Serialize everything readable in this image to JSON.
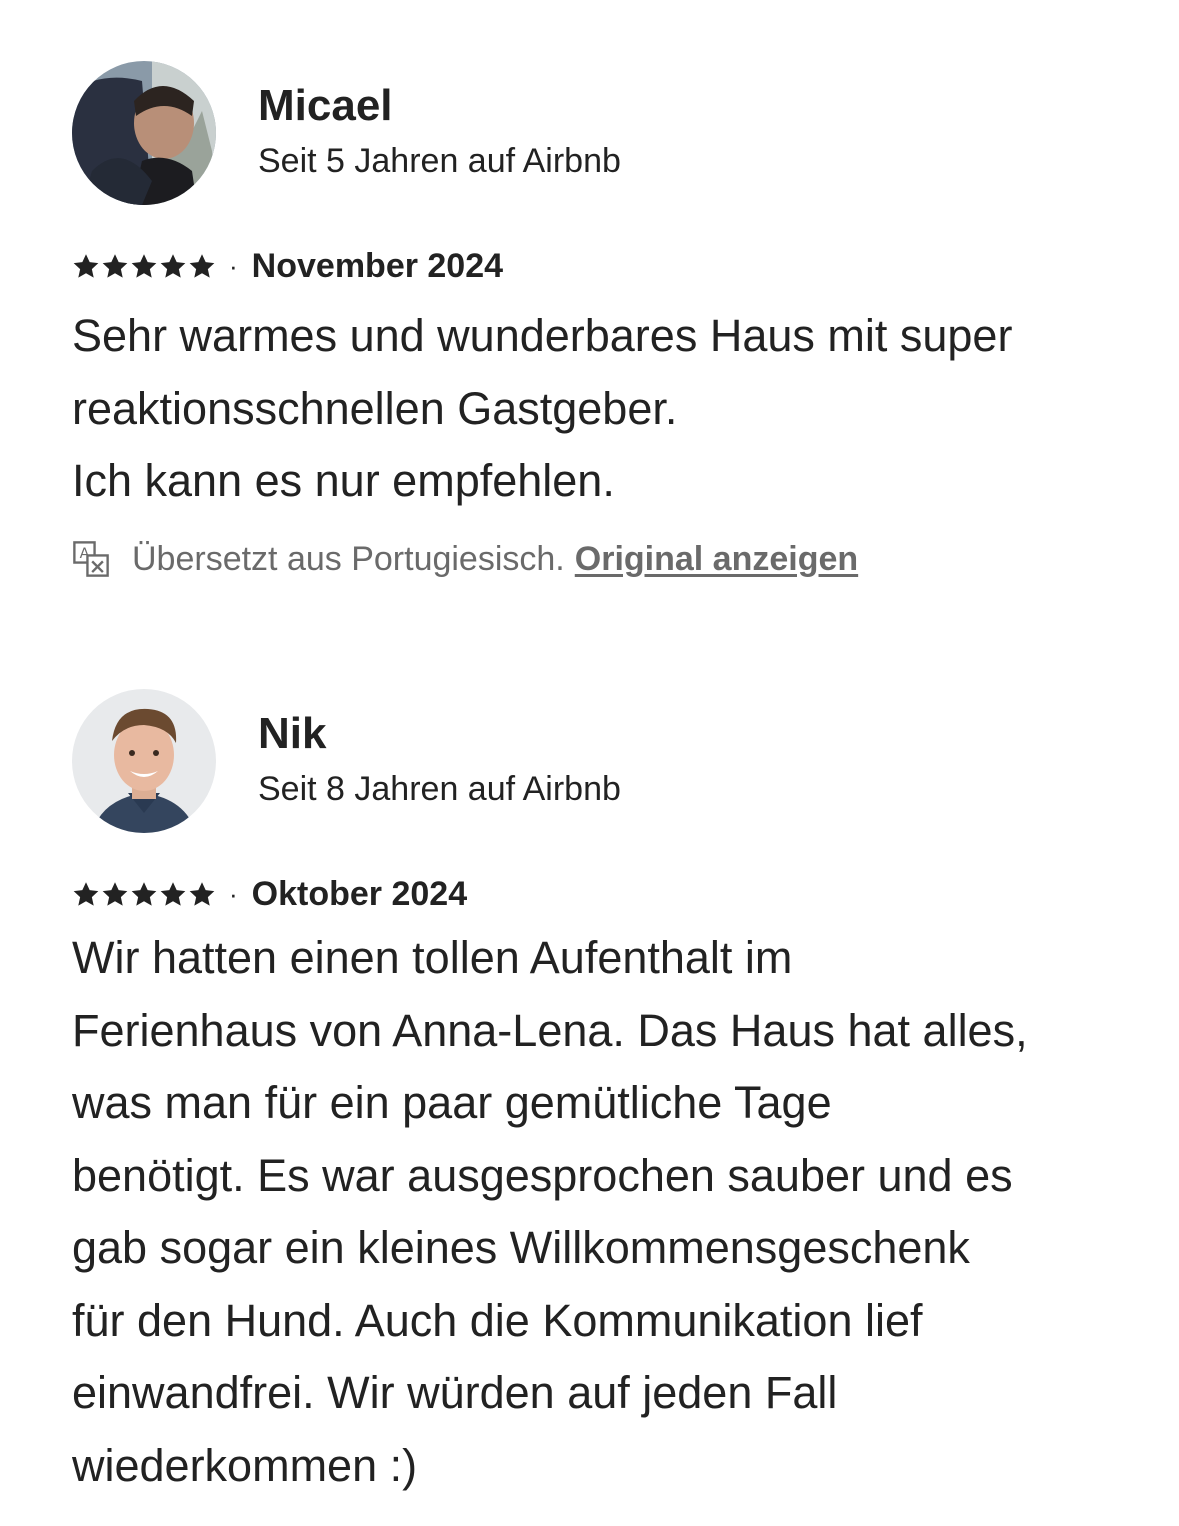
{
  "reviews": [
    {
      "reviewer_name": "Micael",
      "member_since": "Seit 5 Jahren auf Airbnb",
      "rating": 5,
      "separator": "·",
      "date": "November 2024",
      "text": "Sehr warmes und wunderbares Haus mit super\nreaktionsschnellen Gastgeber.\nIch kann es nur empfehlen.",
      "translation_note": "Übersetzt aus Portugiesisch.",
      "translation_link": "Original anzeigen"
    },
    {
      "reviewer_name": "Nik",
      "member_since": "Seit 8 Jahren auf Airbnb",
      "rating": 5,
      "separator": "·",
      "date": "Oktober 2024",
      "text": "Wir hatten einen tollen Aufenthalt im\nFerienhaus von Anna-Lena. Das Haus hat alles,\nwas man für ein paar gemütliche Tage\nbenötigt. Es war ausgesprochen sauber und es\ngab sogar ein kleines Willkommensgeschenk\nfür den Hund. Auch die Kommunikation lief\neinwandfrei.  Wir würden auf jeden Fall\nwiederkommen :)"
    }
  ],
  "icons": {
    "star": "star-icon",
    "translate": "translate-icon"
  },
  "colors": {
    "text": "#222222",
    "secondary_text": "#6a6a6a"
  }
}
